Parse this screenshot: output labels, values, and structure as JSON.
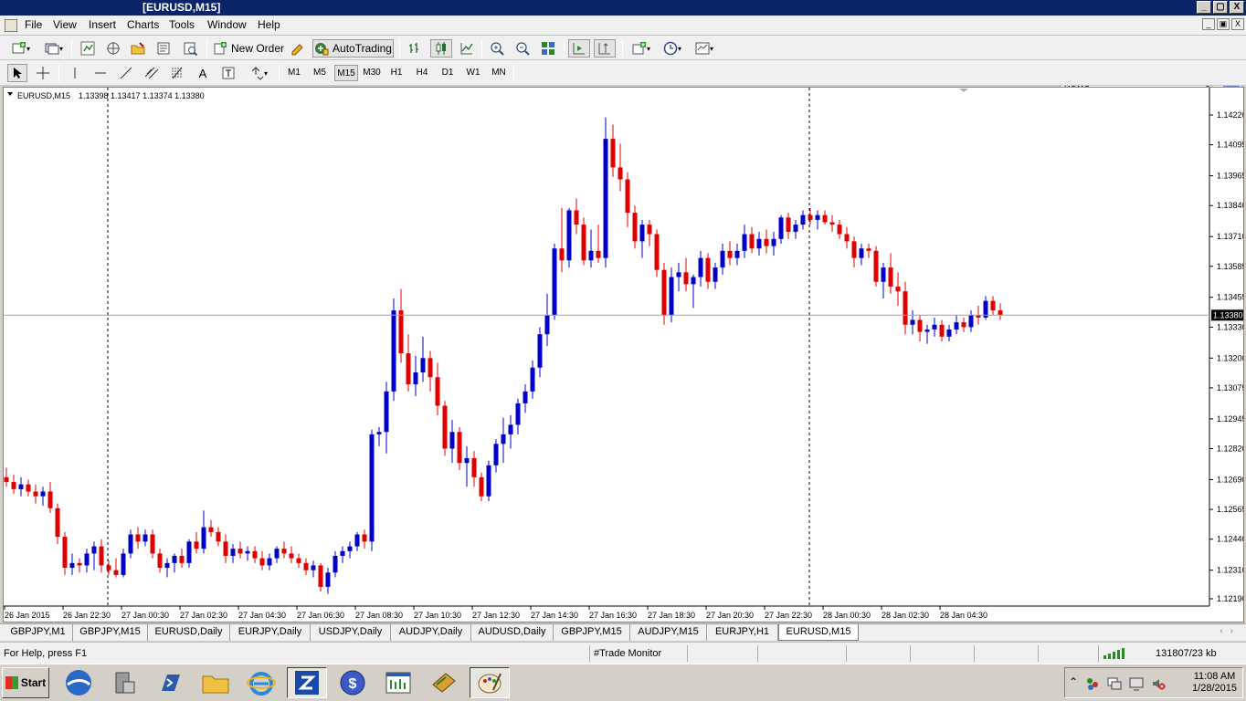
{
  "window": {
    "title": "[EURUSD,M15]",
    "min": "_",
    "max": "▢",
    "close": "X"
  },
  "menu": [
    "File",
    "View",
    "Insert",
    "Charts",
    "Tools",
    "Window",
    "Help"
  ],
  "toolbar": {
    "new_order": "New Order",
    "autotrading": "AutoTrading",
    "search_value": "news",
    "icons": [
      "new-chart-icon",
      "profiles-icon",
      "market-watch-icon",
      "navigator-icon",
      "data-window-icon",
      "terminal-icon",
      "strategy-tester-icon",
      "new-order-icon",
      "metaeditor-icon",
      "autotrading-icon",
      "bar-chart-icon",
      "candlestick-icon",
      "line-chart-icon",
      "zoom-in-icon",
      "zoom-out-icon",
      "tile-windows-icon",
      "autoscroll-icon",
      "chart-shift-icon",
      "indicators-icon",
      "periods-icon",
      "templates-icon"
    ]
  },
  "drawing_tools": [
    "cursor-icon",
    "crosshair-icon",
    "vertical-line-icon",
    "horizontal-line-icon",
    "trendline-icon",
    "equidistant-channel-icon",
    "fibonacci-icon",
    "text-icon",
    "text-label-icon",
    "arrows-icon"
  ],
  "timeframes": [
    "M1",
    "M5",
    "M15",
    "M30",
    "H1",
    "H4",
    "D1",
    "W1",
    "MN"
  ],
  "active_timeframe": "M15",
  "chart_header": {
    "symbol": "EURUSD,M15",
    "ohlc": "1.13398 1.13417 1.13374 1.13380"
  },
  "chart_data": {
    "type": "candlestick",
    "symbol": "EURUSD",
    "timeframe": "M15",
    "price_ticks": [
      "1.14220",
      "1.14095",
      "1.13965",
      "1.13840",
      "1.13710",
      "1.13585",
      "1.13455",
      "1.13330",
      "1.13200",
      "1.13075",
      "1.12945",
      "1.12820",
      "1.12690",
      "1.12565",
      "1.12440",
      "1.12310",
      "1.12190"
    ],
    "ylim": [
      1.1219,
      1.1422
    ],
    "current_price": "1.13380",
    "time_ticks": [
      "26 Jan 2015",
      "26 Jan 22:30",
      "27 Jan 00:30",
      "27 Jan 02:30",
      "27 Jan 04:30",
      "27 Jan 06:30",
      "27 Jan 08:30",
      "27 Jan 10:30",
      "27 Jan 12:30",
      "27 Jan 14:30",
      "27 Jan 16:30",
      "27 Jan 18:30",
      "27 Jan 20:30",
      "27 Jan 22:30",
      "28 Jan 00:30",
      "28 Jan 02:30",
      "28 Jan 04:30"
    ],
    "period_separators": [
      "26 Jan 22:30",
      "27 Jan 22:30"
    ],
    "colors": {
      "bull": "#0000c8",
      "bear": "#e00000",
      "wick": "#000000",
      "background": "#ffffff"
    },
    "candles": [
      [
        1.127,
        1.1274,
        1.1266,
        1.1268
      ],
      [
        1.1268,
        1.1271,
        1.1263,
        1.1265
      ],
      [
        1.1265,
        1.127,
        1.1262,
        1.1267
      ],
      [
        1.1267,
        1.1269,
        1.1262,
        1.1264
      ],
      [
        1.1264,
        1.1267,
        1.1259,
        1.1262
      ],
      [
        1.1262,
        1.1266,
        1.1258,
        1.1264
      ],
      [
        1.1264,
        1.1268,
        1.1255,
        1.1257
      ],
      [
        1.1257,
        1.1259,
        1.1242,
        1.1245
      ],
      [
        1.1245,
        1.1247,
        1.1229,
        1.1232
      ],
      [
        1.1232,
        1.1238,
        1.1229,
        1.1234
      ],
      [
        1.1234,
        1.1236,
        1.123,
        1.1233
      ],
      [
        1.1233,
        1.124,
        1.123,
        1.1238
      ],
      [
        1.1238,
        1.1243,
        1.1231,
        1.1241
      ],
      [
        1.1241,
        1.1244,
        1.123,
        1.1233
      ],
      [
        1.1233,
        1.1235,
        1.1229,
        1.1231
      ],
      [
        1.1231,
        1.1236,
        1.1228,
        1.1229
      ],
      [
        1.1229,
        1.124,
        1.1228,
        1.1238
      ],
      [
        1.1238,
        1.1248,
        1.1236,
        1.1246
      ],
      [
        1.1246,
        1.1249,
        1.124,
        1.1243
      ],
      [
        1.1243,
        1.1248,
        1.1241,
        1.1246
      ],
      [
        1.1246,
        1.1248,
        1.1236,
        1.1238
      ],
      [
        1.1238,
        1.124,
        1.123,
        1.1232
      ],
      [
        1.1232,
        1.1236,
        1.1228,
        1.1234
      ],
      [
        1.1234,
        1.1238,
        1.123,
        1.1237
      ],
      [
        1.1237,
        1.124,
        1.1232,
        1.1234
      ],
      [
        1.1234,
        1.1244,
        1.1232,
        1.1243
      ],
      [
        1.1243,
        1.1247,
        1.1238,
        1.124
      ],
      [
        1.124,
        1.1256,
        1.1238,
        1.1249
      ],
      [
        1.1249,
        1.1252,
        1.1245,
        1.1247
      ],
      [
        1.1247,
        1.1249,
        1.1241,
        1.1243
      ],
      [
        1.1243,
        1.1246,
        1.1234,
        1.1237
      ],
      [
        1.1237,
        1.1242,
        1.1234,
        1.124
      ],
      [
        1.124,
        1.1243,
        1.1236,
        1.1238
      ],
      [
        1.1238,
        1.1241,
        1.1235,
        1.1239
      ],
      [
        1.1239,
        1.1241,
        1.1234,
        1.1236
      ],
      [
        1.1236,
        1.1239,
        1.1231,
        1.1233
      ],
      [
        1.1233,
        1.1238,
        1.1231,
        1.1236
      ],
      [
        1.1236,
        1.1241,
        1.1234,
        1.124
      ],
      [
        1.124,
        1.1243,
        1.1236,
        1.1238
      ],
      [
        1.1238,
        1.1241,
        1.1234,
        1.1236
      ],
      [
        1.1236,
        1.1238,
        1.1232,
        1.1234
      ],
      [
        1.1234,
        1.1236,
        1.1229,
        1.1231
      ],
      [
        1.1231,
        1.1235,
        1.1228,
        1.1233
      ],
      [
        1.1233,
        1.1234,
        1.1222,
        1.1224
      ],
      [
        1.1224,
        1.1232,
        1.1221,
        1.123
      ],
      [
        1.123,
        1.1239,
        1.1228,
        1.1237
      ],
      [
        1.1237,
        1.1241,
        1.1234,
        1.1239
      ],
      [
        1.1239,
        1.1243,
        1.1236,
        1.1241
      ],
      [
        1.1241,
        1.1247,
        1.1239,
        1.1246
      ],
      [
        1.1246,
        1.1248,
        1.124,
        1.1243
      ],
      [
        1.1243,
        1.129,
        1.1239,
        1.1288
      ],
      [
        1.1288,
        1.1291,
        1.1283,
        1.1289
      ],
      [
        1.1289,
        1.131,
        1.128,
        1.1306
      ],
      [
        1.1306,
        1.1345,
        1.1302,
        1.134
      ],
      [
        1.134,
        1.1349,
        1.1318,
        1.1322
      ],
      [
        1.1322,
        1.133,
        1.1306,
        1.1309
      ],
      [
        1.1309,
        1.1321,
        1.1304,
        1.1314
      ],
      [
        1.1314,
        1.1329,
        1.131,
        1.132
      ],
      [
        1.132,
        1.1323,
        1.1306,
        1.1312
      ],
      [
        1.1312,
        1.1318,
        1.1296,
        1.13
      ],
      [
        1.13,
        1.1302,
        1.1279,
        1.1282
      ],
      [
        1.1282,
        1.1294,
        1.1276,
        1.1289
      ],
      [
        1.1289,
        1.1291,
        1.1273,
        1.1276
      ],
      [
        1.1276,
        1.1283,
        1.1266,
        1.1278
      ],
      [
        1.1278,
        1.1281,
        1.1266,
        1.127
      ],
      [
        1.127,
        1.1272,
        1.126,
        1.1262
      ],
      [
        1.1262,
        1.1277,
        1.126,
        1.1275
      ],
      [
        1.1275,
        1.1286,
        1.1272,
        1.1284
      ],
      [
        1.1284,
        1.1295,
        1.1276,
        1.1288
      ],
      [
        1.1288,
        1.1296,
        1.1282,
        1.1292
      ],
      [
        1.1292,
        1.1303,
        1.1288,
        1.1301
      ],
      [
        1.1301,
        1.1309,
        1.1297,
        1.1306
      ],
      [
        1.1306,
        1.1319,
        1.1303,
        1.1316
      ],
      [
        1.1316,
        1.1333,
        1.1312,
        1.133
      ],
      [
        1.133,
        1.1347,
        1.1325,
        1.1338
      ],
      [
        1.1338,
        1.1368,
        1.1336,
        1.1366
      ],
      [
        1.1366,
        1.1383,
        1.1356,
        1.1361
      ],
      [
        1.1361,
        1.1383,
        1.1358,
        1.1382
      ],
      [
        1.1382,
        1.1387,
        1.1372,
        1.1376
      ],
      [
        1.1376,
        1.1379,
        1.1359,
        1.1361
      ],
      [
        1.1361,
        1.1374,
        1.1358,
        1.1365
      ],
      [
        1.1365,
        1.1376,
        1.136,
        1.1362
      ],
      [
        1.1362,
        1.1421,
        1.1358,
        1.1412
      ],
      [
        1.1412,
        1.1418,
        1.1396,
        1.14
      ],
      [
        1.14,
        1.141,
        1.139,
        1.1395
      ],
      [
        1.1395,
        1.1398,
        1.1375,
        1.1381
      ],
      [
        1.1381,
        1.1384,
        1.1366,
        1.1369
      ],
      [
        1.1369,
        1.1378,
        1.1362,
        1.1376
      ],
      [
        1.1376,
        1.1378,
        1.1367,
        1.1372
      ],
      [
        1.1372,
        1.1374,
        1.1354,
        1.1357
      ],
      [
        1.1357,
        1.136,
        1.1334,
        1.1338
      ],
      [
        1.1338,
        1.1358,
        1.1335,
        1.1354
      ],
      [
        1.1354,
        1.136,
        1.1348,
        1.1356
      ],
      [
        1.1356,
        1.1362,
        1.1348,
        1.1351
      ],
      [
        1.1351,
        1.1355,
        1.1341,
        1.1354
      ],
      [
        1.1354,
        1.1365,
        1.135,
        1.1362
      ],
      [
        1.1362,
        1.1364,
        1.1349,
        1.1352
      ],
      [
        1.1352,
        1.136,
        1.1349,
        1.1358
      ],
      [
        1.1358,
        1.1368,
        1.1355,
        1.1365
      ],
      [
        1.1365,
        1.1369,
        1.1359,
        1.1362
      ],
      [
        1.1362,
        1.1368,
        1.1359,
        1.1365
      ],
      [
        1.1365,
        1.1376,
        1.1362,
        1.1372
      ],
      [
        1.1372,
        1.1375,
        1.1364,
        1.1366
      ],
      [
        1.1366,
        1.1373,
        1.1363,
        1.137
      ],
      [
        1.137,
        1.1374,
        1.1364,
        1.1367
      ],
      [
        1.1367,
        1.1373,
        1.1363,
        1.137
      ],
      [
        1.137,
        1.138,
        1.1368,
        1.1379
      ],
      [
        1.1379,
        1.1381,
        1.137,
        1.1373
      ],
      [
        1.1373,
        1.1378,
        1.137,
        1.1376
      ],
      [
        1.1376,
        1.1382,
        1.1374,
        1.138
      ],
      [
        1.138,
        1.1383,
        1.1376,
        1.1378
      ],
      [
        1.1378,
        1.1382,
        1.1374,
        1.138
      ],
      [
        1.138,
        1.1382,
        1.1376,
        1.1377
      ],
      [
        1.1377,
        1.138,
        1.1373,
        1.1376
      ],
      [
        1.1376,
        1.1378,
        1.137,
        1.1372
      ],
      [
        1.1372,
        1.1375,
        1.1366,
        1.1369
      ],
      [
        1.1369,
        1.1371,
        1.1358,
        1.1362
      ],
      [
        1.1362,
        1.1368,
        1.1359,
        1.1366
      ],
      [
        1.1366,
        1.1368,
        1.1362,
        1.1365
      ],
      [
        1.1365,
        1.1367,
        1.135,
        1.1352
      ],
      [
        1.1352,
        1.136,
        1.1345,
        1.1358
      ],
      [
        1.1358,
        1.1364,
        1.1347,
        1.135
      ],
      [
        1.135,
        1.1356,
        1.1342,
        1.1348
      ],
      [
        1.1348,
        1.1352,
        1.133,
        1.1334
      ],
      [
        1.1334,
        1.134,
        1.133,
        1.1336
      ],
      [
        1.1336,
        1.1338,
        1.1327,
        1.1331
      ],
      [
        1.1331,
        1.1334,
        1.1326,
        1.1332
      ],
      [
        1.1332,
        1.1337,
        1.1329,
        1.1334
      ],
      [
        1.1334,
        1.1336,
        1.1327,
        1.1329
      ],
      [
        1.1329,
        1.1334,
        1.1327,
        1.1332
      ],
      [
        1.1332,
        1.1338,
        1.133,
        1.1335
      ],
      [
        1.1335,
        1.1337,
        1.1331,
        1.1333
      ],
      [
        1.1333,
        1.134,
        1.1331,
        1.1338
      ],
      [
        1.1338,
        1.1342,
        1.1334,
        1.1337
      ],
      [
        1.1337,
        1.1346,
        1.1336,
        1.1344
      ],
      [
        1.1344,
        1.1346,
        1.1338,
        1.134
      ],
      [
        1.134,
        1.1343,
        1.1336,
        1.1338
      ]
    ]
  },
  "tabs": [
    "GBPJPY,M1",
    "GBPJPY,M15",
    "EURUSD,Daily",
    "EURJPY,Daily",
    "USDJPY,Daily",
    "AUDJPY,Daily",
    "AUDUSD,Daily",
    "GBPJPY,M15",
    "AUDJPY,M15",
    "EURJPY,H1",
    "EURUSD,M15"
  ],
  "active_tab": "EURUSD,M15",
  "status": {
    "help": "For Help, press F1",
    "profile": "#Trade Monitor",
    "traffic": "131807/23 kb"
  },
  "taskbar": {
    "start": "Start",
    "apps": [
      "ie-icon",
      "server-icon",
      "powershell-icon",
      "folder-icon",
      "internet-explorer-icon",
      "zulutrade-icon",
      "currency-icon",
      "mt4-icon",
      "books-icon",
      "paint-icon"
    ],
    "time": "11:08 AM",
    "date": "1/28/2015"
  }
}
